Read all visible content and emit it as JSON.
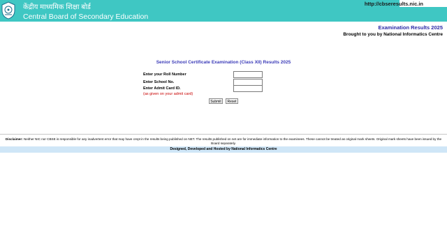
{
  "header": {
    "org_hindi": "केंद्रीय माध्यमिक शिक्षा बोर्ड",
    "org_english": "Central Board of Secondary Education",
    "site_url": "http://cbseresults.nic.in",
    "bg_color": "#3fc7c3"
  },
  "titles": {
    "exam_results": "Examination Results 2025",
    "brought_by": "Brought to you by National Informatics Centre",
    "form_title": "Senior School Certificate Examination (Class XII) Results 2025"
  },
  "form": {
    "roll_label": "Enter your Roll Number",
    "roll_value": "",
    "school_label": "Enter School No.",
    "school_value": "",
    "admit_label": "Enter Admit Card ID.",
    "admit_value": "",
    "admit_note": "(as given on your admit card)",
    "submit_label": "Submit",
    "reset_label": "Reset"
  },
  "disclaimer": {
    "label": "Disclaimer:",
    "text": " Neither NIC nor CBSE is responsible for any inadvertent error that may have crept in the results being published on NET. The results published on net are for immediate information to the examinees. These cannot be treated as original mark sheets. Original mark sheets have been issued by the Board separately."
  },
  "footer": {
    "credit": "Designed, Developed and Hosted by National Informatics Centre"
  },
  "icons": {
    "logo": "cbse-emblem-icon"
  }
}
